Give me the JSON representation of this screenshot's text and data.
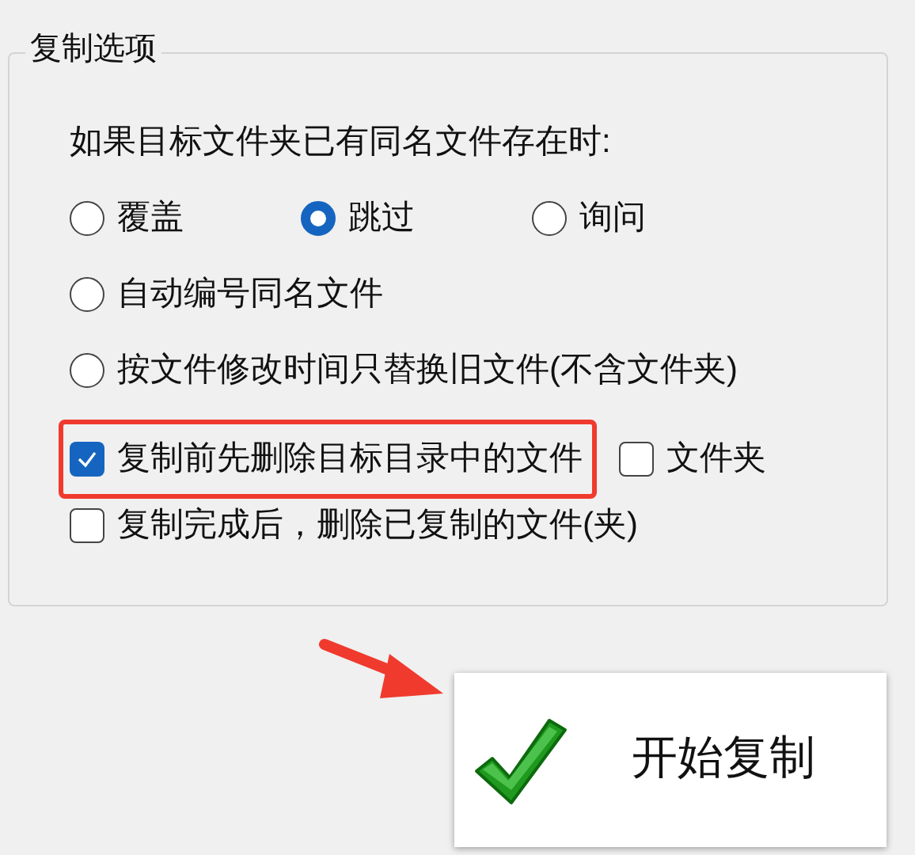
{
  "group_title": "复制选项",
  "prompt": "如果目标文件夹已有同名文件存在时:",
  "conflict_options": [
    {
      "label": "覆盖",
      "selected": false
    },
    {
      "label": "跳过",
      "selected": true
    },
    {
      "label": "询问",
      "selected": false
    },
    {
      "label": "自动编号同名文件",
      "selected": false
    },
    {
      "label": "按文件修改时间只替换旧文件(不含文件夹)",
      "selected": false
    }
  ],
  "checkbox_rows": [
    [
      {
        "label": "复制前先删除目标目录中的文件",
        "checked": true,
        "highlighted": true
      },
      {
        "label": "文件夹",
        "checked": false,
        "highlighted": false
      }
    ],
    [
      {
        "label": "复制完成后，删除已复制的文件(夹)",
        "checked": false,
        "highlighted": false
      }
    ]
  ],
  "start_button": {
    "label": "开始复制"
  }
}
